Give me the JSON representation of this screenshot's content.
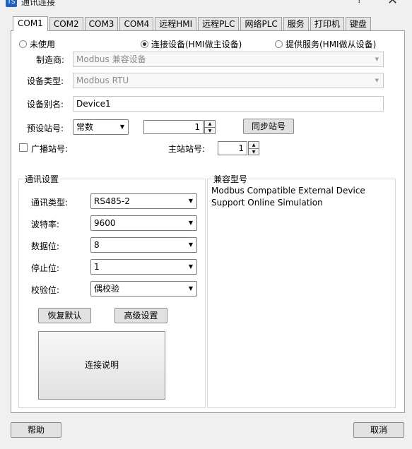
{
  "window": {
    "title": "通讯连接",
    "app_icon": "TS",
    "help_glyph": "?",
    "close_glyph": "✕"
  },
  "tabs": [
    "COM1",
    "COM2",
    "COM3",
    "COM4",
    "远程HMI",
    "远程PLC",
    "网络PLC",
    "服务",
    "打印机",
    "键盘"
  ],
  "mode": {
    "unused": "未使用",
    "connect": "连接设备(HMI做主设备)",
    "serve": "提供服务(HMI做从设备)",
    "selected": "connect"
  },
  "manufacturer": {
    "label": "制造商:",
    "value": "Modbus 兼容设备"
  },
  "device_type": {
    "label": "设备类型:",
    "value": "Modbus RTU"
  },
  "alias": {
    "label": "设备别名:",
    "value": "Device1"
  },
  "station": {
    "label": "预设站号:",
    "mode_value": "常数",
    "number": "1",
    "sync_button": "同步站号"
  },
  "broadcast": {
    "label": "广播站号:",
    "master_label": "主站站号:",
    "master_value": "1"
  },
  "comm": {
    "title": "通讯设置",
    "type_label": "通讯类型:",
    "type_value": "RS485-2",
    "baud_label": "波特率:",
    "baud_value": "9600",
    "data_label": "数据位:",
    "data_value": "8",
    "stop_label": "停止位:",
    "stop_value": "1",
    "parity_label": "校验位:",
    "parity_value": "偶校验",
    "restore_button": "恢复默认",
    "advanced_button": "高级设置",
    "explain_button": "连接说明"
  },
  "compat": {
    "title": "兼容型号",
    "line1": "Modbus Compatible External Device",
    "line2": "Support Online Simulation"
  },
  "footer": {
    "help_button": "帮助",
    "cancel_button": "取消"
  },
  "colors": {
    "background": "#f0f0f0",
    "panel": "#ffffff",
    "border": "#a0a0a0"
  }
}
